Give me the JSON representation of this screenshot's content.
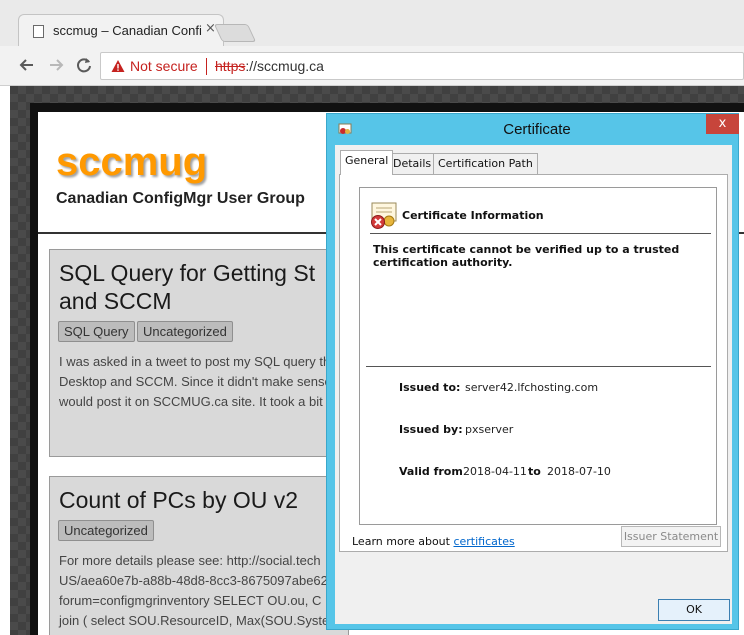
{
  "browser": {
    "tab_title": "sccmug – Canadian Confi",
    "tab_close": "×",
    "security_label": "Not secure",
    "url_scheme": "https",
    "url_rest": "://sccmug.ca",
    "icons": {
      "back": "arrow-left",
      "forward": "arrow-right",
      "reload": "reload",
      "warning": "warning-triangle",
      "page": "document"
    }
  },
  "site": {
    "title": "sccmug",
    "tagline": "Canadian ConfigMgr User Group",
    "posts": [
      {
        "title_line1": "SQL Query for Getting St",
        "title_line2": "and SCCM",
        "tags": [
          "SQL Query",
          "Uncategorized"
        ],
        "excerpt": [
          "I was asked in a tweet to post my SQL query th",
          "Desktop and SCCM. Since it didn't make sense",
          "would post it on SCCMUG.ca site. It took a bit"
        ]
      },
      {
        "title_line1": "Count of PCs by OU v2",
        "tags": [
          "Uncategorized"
        ],
        "excerpt": [
          "  For more details please see: http://social.tech",
          "US/aea60e7b-a88b-48d8-8cc3-8675097abe62",
          "forum=configmgrinventory   SELECT OU.ou, C",
          "join ( select SOU.ResourceID, Max(SOU.Syste"
        ]
      }
    ],
    "brand_color": "#ff9900"
  },
  "dialog": {
    "title": "Certificate",
    "close": "x",
    "tabs": [
      "General",
      "Details",
      "Certification Path"
    ],
    "active_tab": "General",
    "info_heading": "Certificate Information",
    "message": "This certificate cannot be verified up to a trusted certification authority.",
    "issued_to_label": "Issued to:",
    "issued_to_value": "server42.lfchosting.com",
    "issued_by_label": "Issued by:",
    "issued_by_value": "pxserver",
    "valid_from_label": "Valid from",
    "valid_from_value": "2018-04-11",
    "valid_to_label": "to",
    "valid_to_value": "2018-07-10",
    "issuer_statement_button": "Issuer Statement",
    "learn_more_prefix": "Learn more about ",
    "learn_more_link": "certificates",
    "ok_button": "OK",
    "titlebar_color": "#56c5e8",
    "icons": {
      "certificate": "certificate-error",
      "close": "close"
    }
  }
}
